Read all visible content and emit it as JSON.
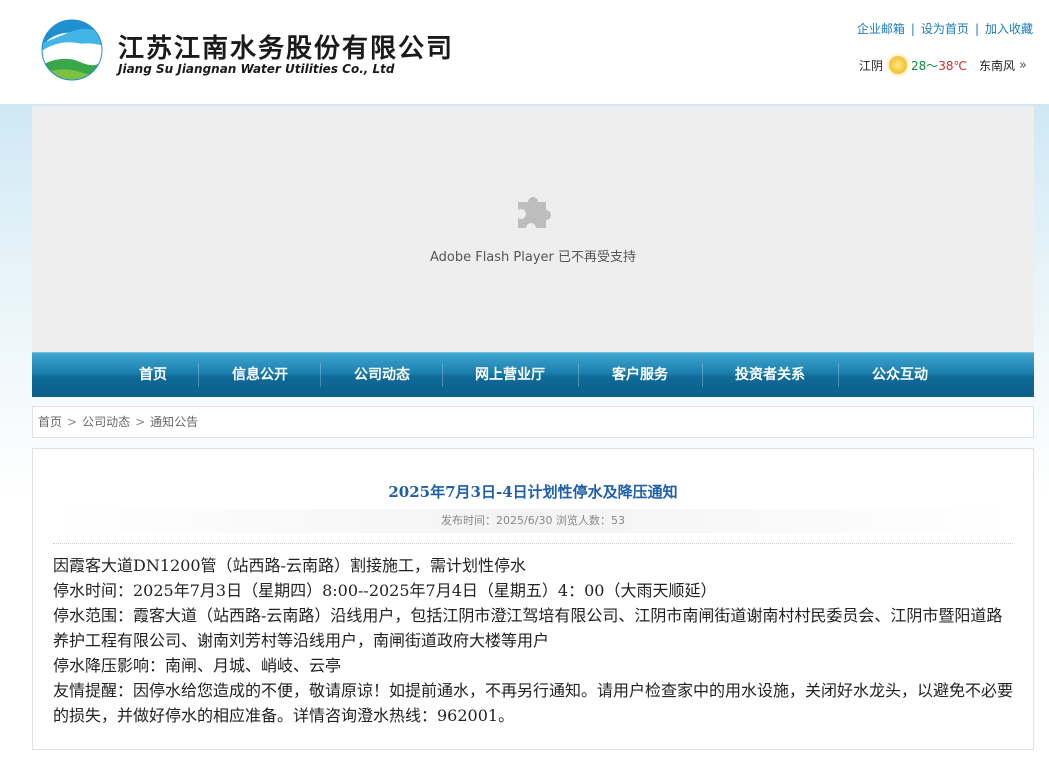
{
  "header": {
    "company_cn": "江苏江南水务股份有限公司",
    "company_en": "Jiang Su Jiangnan Water Utilities Co., Ltd",
    "links": [
      "企业邮箱",
      "设为首页",
      "加入收藏"
    ],
    "weather": {
      "city": "江阴",
      "temp_low": "28",
      "range_sep": "～",
      "temp_high": "38℃",
      "wind": "东南风",
      "more": "»"
    }
  },
  "flash": {
    "icon": "puzzle-piece-icon",
    "message": "Adobe Flash Player 已不再受支持"
  },
  "nav": {
    "items": [
      "首页",
      "信息公开",
      "公司动态",
      "网上营业厅",
      "客户服务",
      "投资者关系",
      "公众互动"
    ]
  },
  "breadcrumb": {
    "items": [
      "首页",
      "公司动态",
      "通知公告"
    ],
    "separator": ">"
  },
  "article": {
    "title": "2025年7月3日-4日计划性停水及降压通知",
    "meta": "发布时间：2025/6/30 浏览人数：53",
    "paragraphs": [
      "因霞客大道DN1200管（站西路-云南路）割接施工，需计划性停水",
      "停水时间：2025年7月3日（星期四）8:00--2025年7月4日（星期五）4：00（大雨天顺延）",
      "停水范围：霞客大道（站西路-云南路）沿线用户，包括江阴市澄江驾培有限公司、江阴市南闸街道谢南村村民委员会、江阴市暨阳道路养护工程有限公司、谢南刘芳村等沿线用户，南闸街道政府大楼等用户",
      "停水降压影响：南闸、月城、峭岐、云亭",
      "友情提醒：因停水给您造成的不便，敬请原谅！如提前通水，不再另行通知。请用户检查家中的用水设施，关闭好水龙头，以避免不必要的损失，并做好停水的相应准备。详情咨询澄水热线：962001。"
    ]
  },
  "colors": {
    "nav_top": "#3fa6cf",
    "nav_bottom": "#0c5f8a",
    "title_blue": "#1e5fa8",
    "link_blue": "#1a7bb8"
  }
}
